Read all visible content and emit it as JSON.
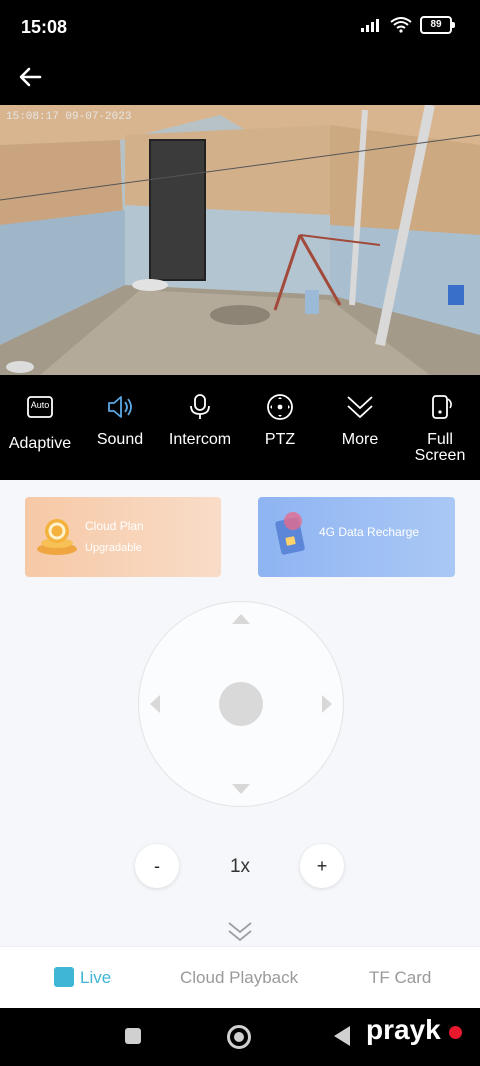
{
  "status_bar": {
    "time": "15:08",
    "battery": "89"
  },
  "video": {
    "timestamp": "15:08:17 09-07-2023"
  },
  "controls": [
    {
      "label": "Adaptive",
      "icon": "auto-quality-icon",
      "badge": "Auto"
    },
    {
      "label": "Sound",
      "icon": "speaker-icon"
    },
    {
      "label": "Intercom",
      "icon": "microphone-icon"
    },
    {
      "label": "PTZ",
      "icon": "ptz-icon"
    },
    {
      "label": "More",
      "icon": "double-chevron-down-icon"
    },
    {
      "label_line1": "Full",
      "label_line2": "Screen",
      "icon": "phone-rotate-icon"
    }
  ],
  "promos": {
    "cloud": {
      "title": "Cloud Plan",
      "subtitle": "Upgradable"
    },
    "data": {
      "title": "4G Data Recharge"
    }
  },
  "zoom": {
    "minus": "-",
    "level": "1x",
    "plus": "+"
  },
  "tabs": {
    "live": "Live",
    "cloud_playback": "Cloud Playback",
    "tf_card": "TF Card",
    "active": "Live"
  },
  "watermark": {
    "brand": "prayk"
  },
  "colors": {
    "accent": "#3fb6d6",
    "sound_icon": "#5aa9e6",
    "cloud_promo": "#f6c9a6",
    "data_promo": "#8eb4f2"
  }
}
